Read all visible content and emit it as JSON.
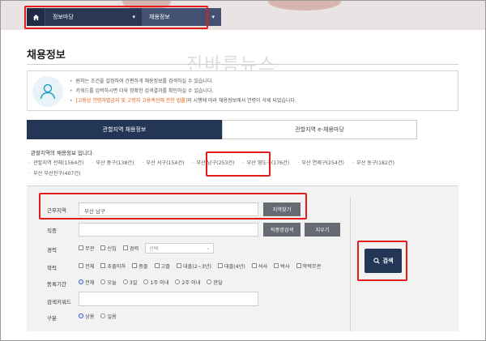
{
  "nav": {
    "seg1_label": "정보마당",
    "seg2_label": "채용정보"
  },
  "page": {
    "title": "채용정보",
    "watermark": "진바름뉴스"
  },
  "notice": {
    "line1": "원하는 조건을 설정하여 간편하게 채용정보를 검색하실 수 있습니다.",
    "line2": "키워드를 입력하시면 더욱 정확한 검색결과를 확인하실 수 있습니다.",
    "line3_red": "[고용상 연령차별금지 및 고령자 고용촉진에 관한 법률]",
    "line3_tail": "의 시행에 따라 채용정보에서 연령이 삭제 되었습니다."
  },
  "tabs": {
    "active": "관할지역 채용정보",
    "inactive": "관할지역 e-채용마당"
  },
  "regions": {
    "heading": "관할지역의 채용정보 입니다.",
    "items": [
      "관할지역 전체(1564건)",
      "부산 중구(138건)",
      "부산 서구(154건)",
      "부산 남구(253건)",
      "부산 영도구(176건)",
      "부산 연제구(254건)",
      "부산 동구(182건)",
      "부산 부산진구(407건)"
    ]
  },
  "form": {
    "area_label": "근무지역",
    "area_value": "부산 남구",
    "area_btn": "지역찾기",
    "job_label": "직종",
    "job_btn": "직종명검색",
    "clear_btn": "지우기",
    "career_label": "경력",
    "career_opts": [
      "무관",
      "신입",
      "경력"
    ],
    "career_select": "선택",
    "edu_label": "학력",
    "edu_opts": [
      "전체",
      "초졸이하",
      "중졸",
      "고졸",
      "대졸(2~3년)",
      "대졸(4년)",
      "석사",
      "박사",
      "학력무관"
    ],
    "period_label": "등록기간",
    "period_opts": [
      "전체",
      "오늘",
      "3일",
      "1주 이내",
      "2주 이내",
      "한달"
    ],
    "keyword_label": "검색키워드",
    "type_label": "구분",
    "type_opts": [
      "상용",
      "일용"
    ],
    "search_btn": "검색"
  }
}
